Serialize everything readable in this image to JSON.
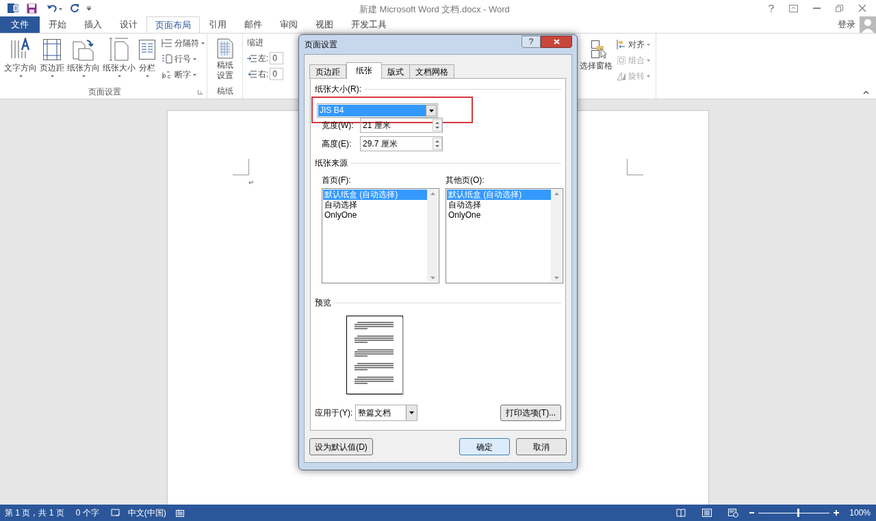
{
  "window": {
    "title": "新建 Microsoft Word 文档.docx - Word",
    "sign_in": "登录"
  },
  "tabs": [
    {
      "label": "文件",
      "kind": "file",
      "selected": false
    },
    {
      "label": "开始",
      "kind": "tab",
      "selected": false
    },
    {
      "label": "插入",
      "kind": "tab",
      "selected": false
    },
    {
      "label": "设计",
      "kind": "tab",
      "selected": false
    },
    {
      "label": "页面布局",
      "kind": "tab",
      "selected": true
    },
    {
      "label": "引用",
      "kind": "tab",
      "selected": false
    },
    {
      "label": "邮件",
      "kind": "tab",
      "selected": false
    },
    {
      "label": "审阅",
      "kind": "tab",
      "selected": false
    },
    {
      "label": "视图",
      "kind": "tab",
      "selected": false
    },
    {
      "label": "开发工具",
      "kind": "tab",
      "selected": false
    }
  ],
  "ribbon": {
    "page_setup": {
      "label": "页面设置",
      "large_buttons": [
        "文字方向",
        "页边距",
        "纸张方向",
        "纸张大小",
        "分栏"
      ],
      "small_buttons": [
        {
          "label": "分隔符",
          "disabled": false
        },
        {
          "label": "行号",
          "disabled": false
        },
        {
          "label": "断字",
          "disabled": false
        }
      ]
    },
    "draft_paper": {
      "label": "稿纸",
      "button": [
        "稿纸",
        "设置"
      ]
    },
    "indent": {
      "label": "缩进",
      "fields": [
        {
          "label": "左:",
          "value": "0"
        },
        {
          "label": "右:",
          "value": "0"
        }
      ]
    },
    "arrange": {
      "large_button": "选择窗格",
      "small_buttons": [
        {
          "label": "对齐",
          "disabled": false
        },
        {
          "label": "组合",
          "disabled": true
        },
        {
          "label": "旋转",
          "disabled": true
        }
      ]
    }
  },
  "document": {
    "paragraph_mark": "↵"
  },
  "dialog": {
    "title": "页面设置",
    "help": "?",
    "tabs": [
      {
        "label": "页边距",
        "selected": false
      },
      {
        "label": "纸张",
        "selected": true
      },
      {
        "label": "版式",
        "selected": false
      },
      {
        "label": "文档网格",
        "selected": false
      }
    ],
    "paper_size": {
      "label": "纸张大小(R):",
      "value": "JIS B4"
    },
    "width": {
      "label": "宽度(W):",
      "value": "21 厘米"
    },
    "height": {
      "label": "高度(E):",
      "value": "29.7 厘米"
    },
    "paper_source": {
      "label": "纸张来源",
      "lists": [
        {
          "label": "首页(F):",
          "items": [
            {
              "label": "默认纸盒 (自动选择)",
              "selected": true
            },
            {
              "label": "自动选择",
              "selected": false
            },
            {
              "label": "OnlyOne",
              "selected": false
            }
          ]
        },
        {
          "label": "其他页(O):",
          "items": [
            {
              "label": "默认纸盒 (自动选择)",
              "selected": true
            },
            {
              "label": "自动选择",
              "selected": false
            },
            {
              "label": "OnlyOne",
              "selected": false
            }
          ]
        }
      ]
    },
    "preview": {
      "label": "预览"
    },
    "apply_to": {
      "label": "应用于(Y):",
      "value": "整篇文档"
    },
    "print_options": "打印选项(T)...",
    "buttons": [
      "设为默认值(D)",
      "确定",
      "取消"
    ]
  },
  "status_bar": {
    "page": "第 1 页，共 1 页",
    "words": "0 个字",
    "language": "中文(中国)",
    "zoom_slider": {
      "level": 0.56
    },
    "zoom": "100%"
  }
}
